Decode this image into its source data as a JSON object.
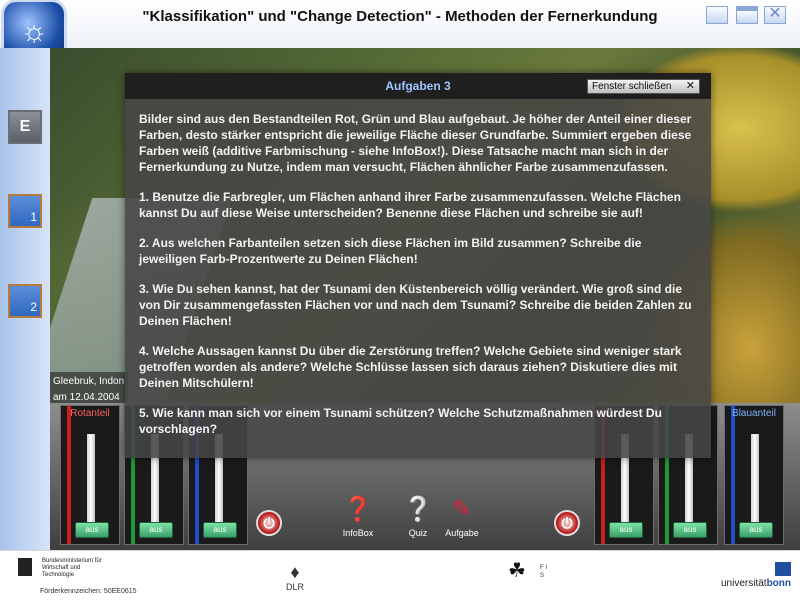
{
  "window": {
    "title": "\"Klassifikation\" und \"Change Detection\" - Methoden der Fernerkundung"
  },
  "sidebar": {
    "items": [
      {
        "label": "E"
      },
      {
        "label": "1"
      },
      {
        "label": "2"
      }
    ]
  },
  "map": {
    "caption_place": "Gleebruk, Indon",
    "caption_date": "am 12.04.2004"
  },
  "dialog": {
    "title": "Aufgaben 3",
    "close_label": "Fenster schließen",
    "close_glyph": "✕",
    "paragraphs": [
      "Bilder sind aus den Bestandteilen Rot, Grün und Blau aufgebaut. Je höher der Anteil einer dieser Farben, desto stärker entspricht die jeweilige Fläche dieser Grundfarbe. Summiert ergeben diese Farben weiß (additive Farbmischung - siehe InfoBox!). Diese Tatsache macht man sich in der Fernerkundung zu Nutze, indem man versucht, Flächen ähnlicher Farbe zusammenzufassen.",
      "1. Benutze die Farbregler, um Flächen anhand ihrer Farbe zusammenzufassen. Welche Flächen kannst Du auf diese Weise unterscheiden? Benenne diese Flächen und schreibe sie auf!",
      "2. Aus welchen Farbanteilen setzen sich diese Flächen im Bild zusammen? Schreibe die jeweiligen Farb-Prozentwerte zu Deinen Flächen!",
      "3. Wie Du sehen kannst, hat der Tsunami den Küstenbereich völlig verändert. Wie groß sind die von Dir zusammengefassten Flächen vor und nach dem Tsunami? Schreibe die beiden Zahlen zu Deinen Flächen!",
      "4. Welche Aussagen kannst Du über die Zerstörung treffen? Welche Gebiete sind weniger stark getroffen worden als andere? Welche Schlüsse lassen sich daraus ziehen? Diskutiere dies mit Deinen Mitschülern!",
      "5. Wie kann man sich vor einem Tsunami schützen? Welche Schutzmaßnahmen würdest Du vorschlagen?"
    ]
  },
  "controls": {
    "left_slot_label": "Rotanteil",
    "right_slot_label": "Blauanteil",
    "aus_label": "aus",
    "colors": {
      "red": "#c81e1e",
      "green": "#1e9a3a",
      "blue": "#1e4fc8"
    }
  },
  "tools": {
    "infobox": "InfoBox",
    "quiz": "Quiz",
    "aufgabe": "Aufgabe"
  },
  "footer": {
    "bmwi_name": "Bundesministerium für Wirtschaft und Technologie",
    "funding": "Förderkennzeichen: 50EE0615",
    "dlr": "DLR",
    "fis": "F I S",
    "bonn_prefix": "universität",
    "bonn_suffix": "bonn"
  }
}
